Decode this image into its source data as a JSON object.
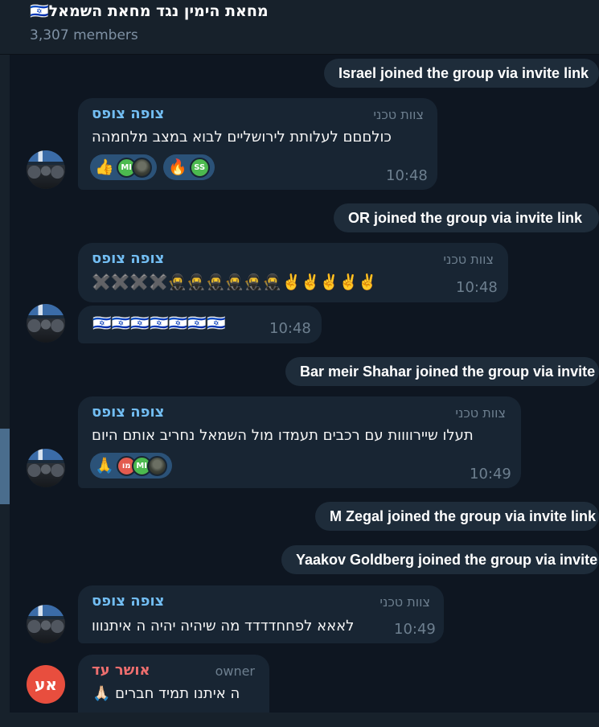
{
  "header": {
    "title": "מחאת הימין נגד מחאת השמאל🇮🇱",
    "members": "3,307 members"
  },
  "colors": {
    "background": "#0e1621",
    "bubble": "#182533",
    "service": "#1e2c3a",
    "sender": "#72bdf2",
    "owner_sender": "#ee6e6e",
    "reaction": "#2b5278"
  },
  "service_messages": [
    "Israel joined the group via invite link",
    "OR joined the group via invite link",
    "Bar meir Shahar joined the group via invite link",
    "M Zegal joined the group via invite link",
    "Yaakov Goldberg joined the group via invite link"
  ],
  "messages": [
    {
      "sender": "צופה צופס",
      "role": "צוות טכני",
      "text": "כולםםם לעלותת לירושליים לבוא במצב מלחמהה",
      "time": "10:48",
      "reactions": [
        {
          "emoji": "👍",
          "users": [
            "MI",
            "photo"
          ]
        },
        {
          "emoji": "🔥",
          "users": [
            "SS"
          ]
        }
      ]
    },
    {
      "sender": "צופה צופס",
      "role": "צוות טכני",
      "text": "✖️✖️✖️✖️🥷🥷🥷🥷🥷🥷✌️✌️✌️✌️✌️",
      "time": "10:48"
    },
    {
      "text": "🇮🇱🇮🇱🇮🇱🇮🇱🇮🇱🇮🇱🇮🇱",
      "time": "10:48"
    },
    {
      "sender": "צופה צופס",
      "role": "צוות טכני",
      "text": "תעלו שיירוווות  עם רכבים תעמדו מול השמאל נחריב אותם היום",
      "time": "10:49",
      "reactions": [
        {
          "emoji": "🙏",
          "users": [
            "מו",
            "MI",
            "photo"
          ]
        }
      ]
    },
    {
      "sender": "צופה צופס",
      "role": "צוות טכני",
      "text": "לאאא לפחחדדדד מה שיהיה יהיה ה איתנווו",
      "time": "10:49"
    },
    {
      "sender": "אושר עד",
      "role": "owner",
      "text": "ה איתנו תמיד חברים 🙏🏻",
      "avatar_initials": "אע"
    }
  ]
}
